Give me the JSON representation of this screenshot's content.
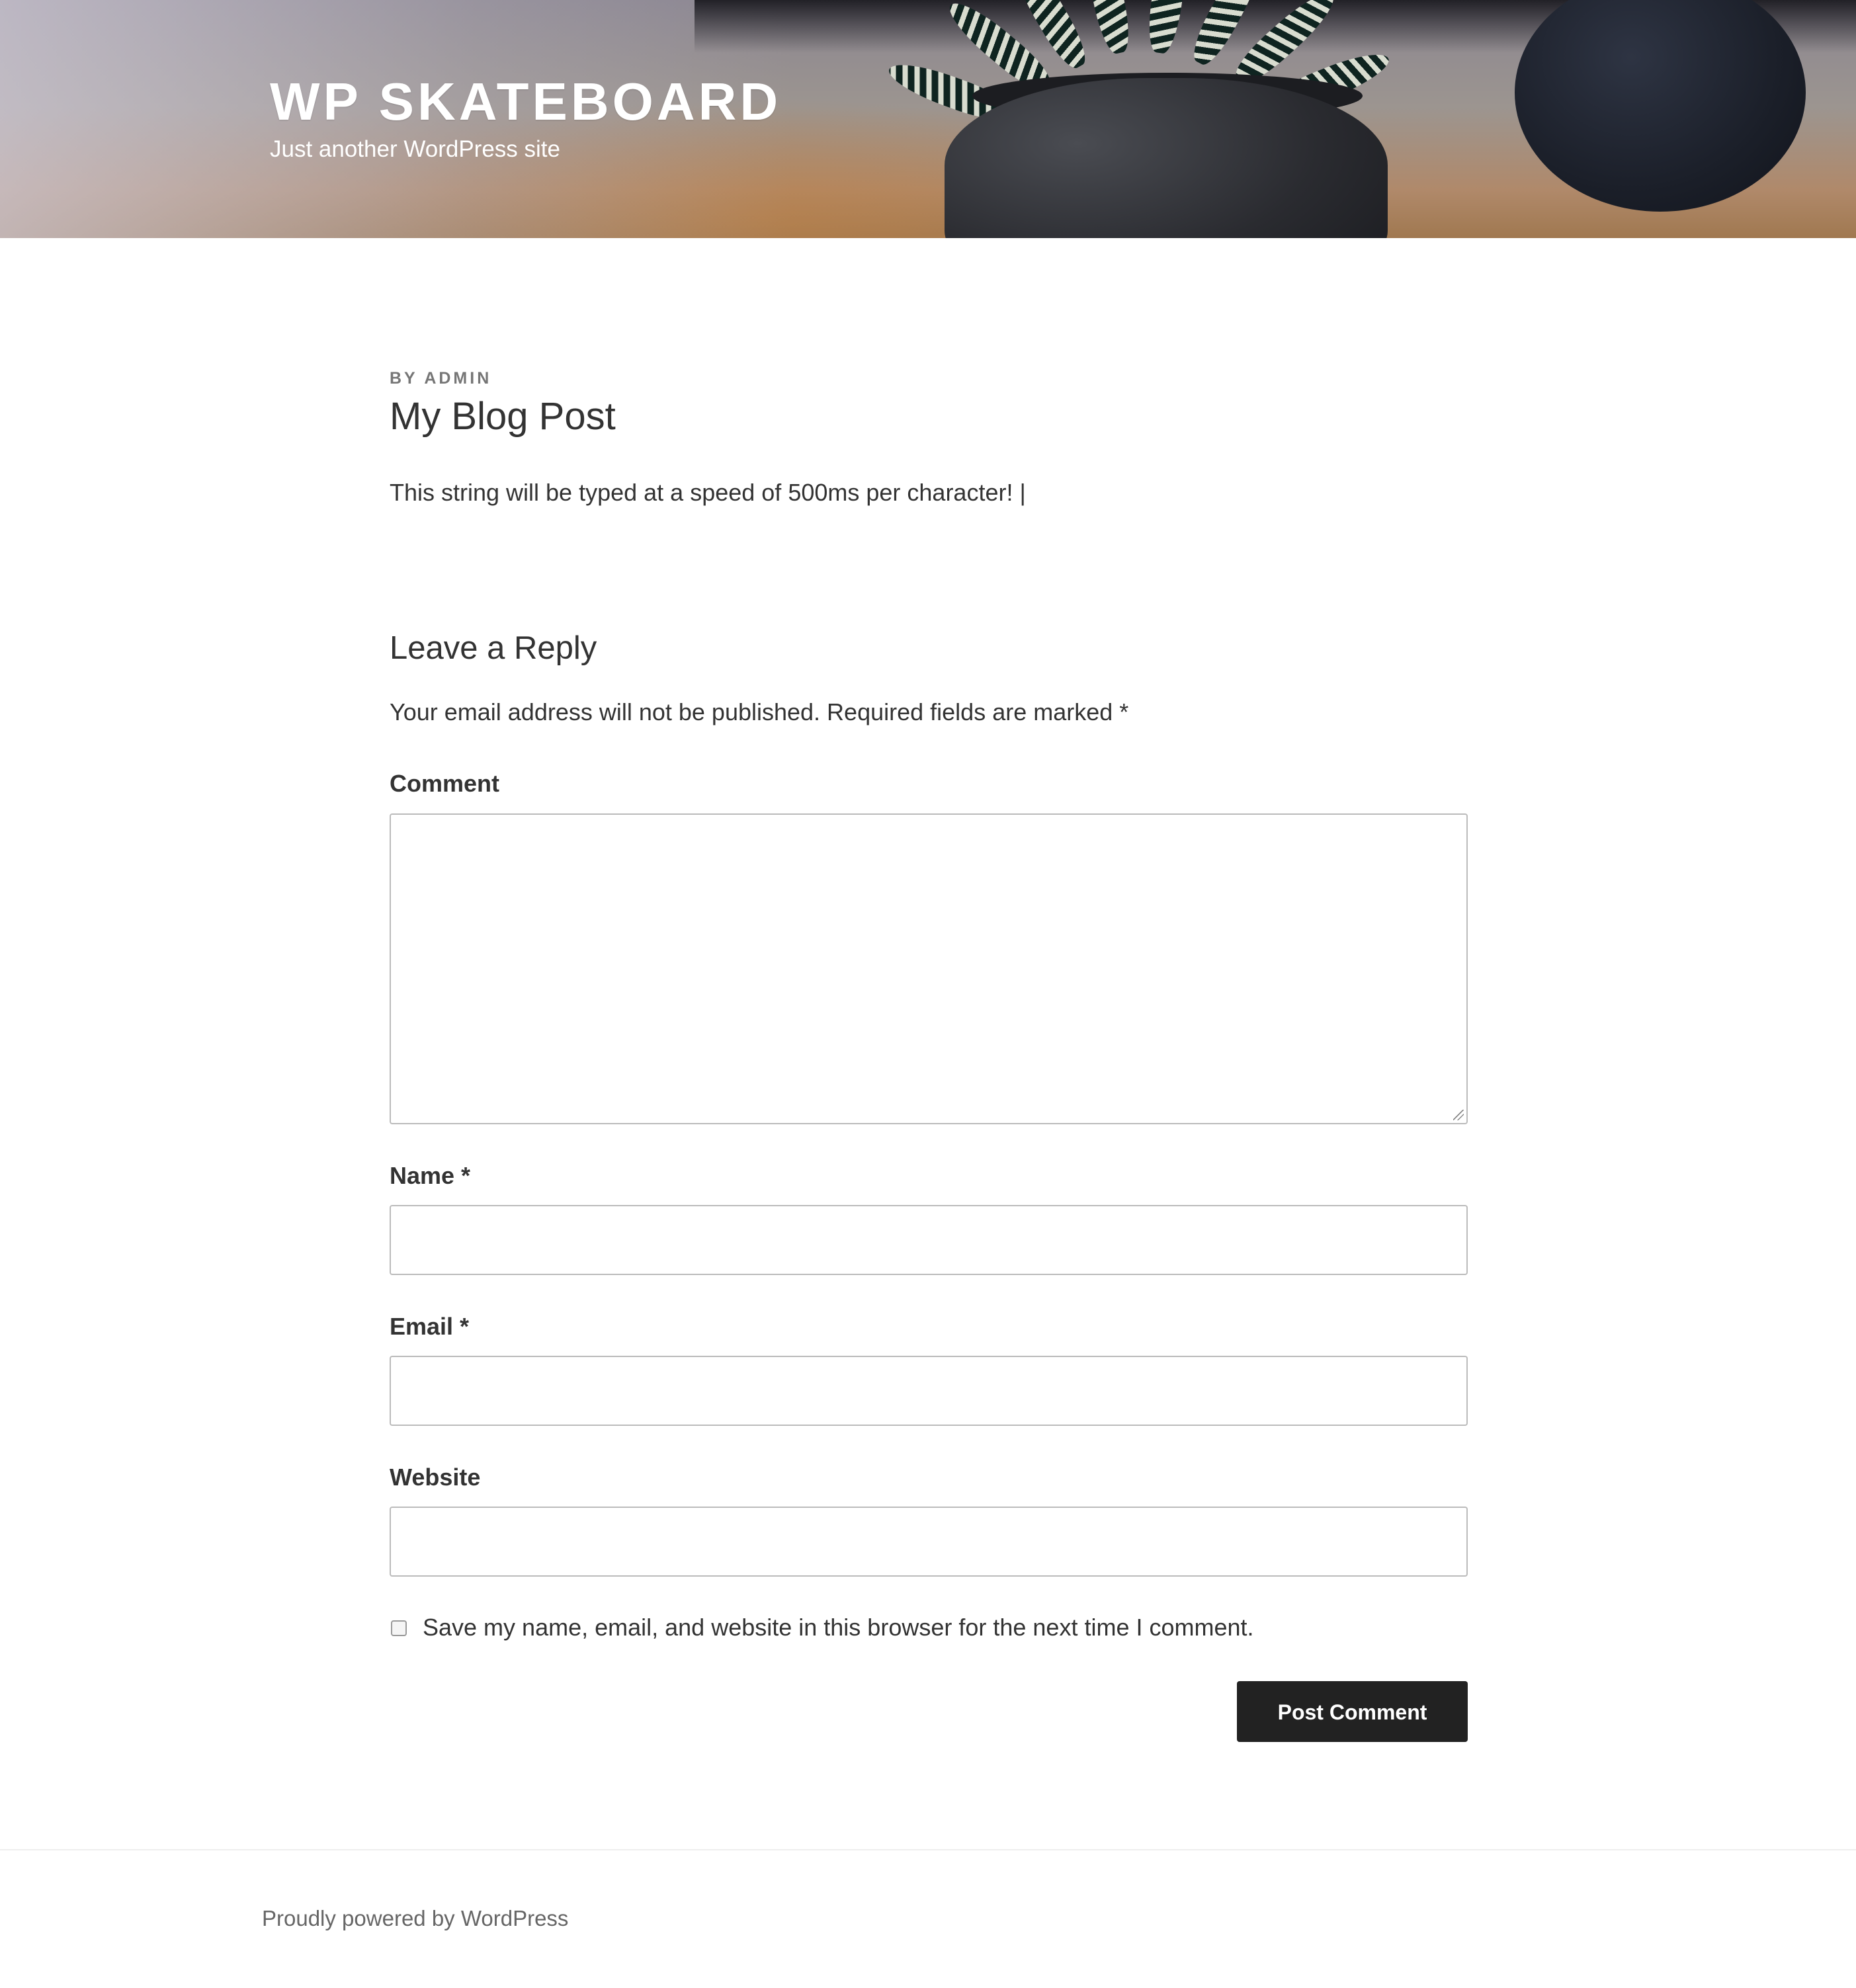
{
  "header": {
    "site_title": "WP SKATEBOARD",
    "tagline": "Just another WordPress site"
  },
  "post": {
    "byline_prefix": "BY",
    "author": "ADMIN",
    "title": "My Blog Post",
    "body": "This string will be typed at a speed of 500ms per character! |"
  },
  "reply": {
    "title": "Leave a Reply",
    "notes": "Your email address will not be published. Required fields are marked *",
    "comment_label": "Comment",
    "comment_value": "",
    "name_label": "Name *",
    "name_value": "",
    "email_label": "Email *",
    "email_value": "",
    "website_label": "Website",
    "website_value": "",
    "cookies_label": "Save my name, email, and website in this browser for the next time I comment.",
    "cookies_checked": false,
    "submit_label": "Post Comment"
  },
  "footer": {
    "powered_by": "Proudly powered by WordPress"
  },
  "colors": {
    "button_bg": "#222222",
    "text": "#333333",
    "muted": "#767676"
  }
}
